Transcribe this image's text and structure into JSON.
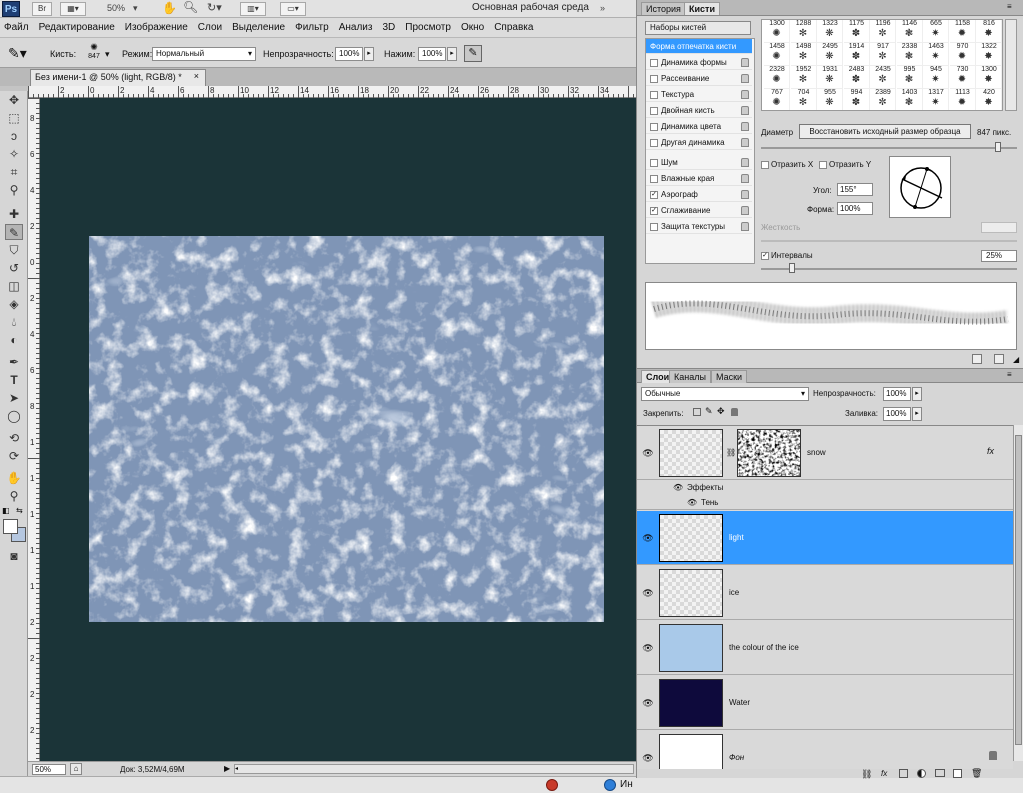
{
  "appbar": {
    "logo": "Ps",
    "br_label": "Br",
    "zoom": "50%",
    "workspace": "Основная рабочая среда"
  },
  "menu": [
    "Файл",
    "Редактирование",
    "Изображение",
    "Слои",
    "Выделение",
    "Фильтр",
    "Анализ",
    "3D",
    "Просмотр",
    "Окно",
    "Справка"
  ],
  "options": {
    "brush_label": "Кисть:",
    "brush_size": "847",
    "mode_label": "Режим:",
    "mode_value": "Нормальный",
    "opacity_label": "Непрозрачность:",
    "opacity_value": "100%",
    "flow_label": "Нажим:",
    "flow_value": "100%"
  },
  "document": {
    "tab_title": "Без имени-1 @ 50% (light, RGB/8) *",
    "close": "×",
    "ruler_h": [
      "2",
      "0",
      "2",
      "4",
      "6",
      "8",
      "10",
      "12",
      "14",
      "16",
      "18",
      "20",
      "22",
      "24",
      "26",
      "28",
      "30",
      "32",
      "34"
    ],
    "ruler_v": [
      "8",
      "6",
      "4",
      "2",
      "0",
      "2",
      "4",
      "6",
      "8",
      "1",
      "1",
      "1",
      "1",
      "1",
      "2",
      "2",
      "2",
      "2"
    ]
  },
  "status": {
    "zoom": "50%",
    "doc": "Док: 3,52M/4,69M"
  },
  "taskbar": {
    "text": "Ин"
  },
  "brush_panel": {
    "tabs": [
      "История",
      "Кисти"
    ],
    "presets_btn": "Наборы кистей",
    "items": [
      {
        "label": "Форма отпечатка кисти",
        "checkbox": false,
        "selected": true,
        "lock": false
      },
      {
        "label": "Динамика формы",
        "checkbox": true,
        "checked": false,
        "lock": true
      },
      {
        "label": "Рассеивание",
        "checkbox": true,
        "checked": false,
        "lock": true
      },
      {
        "label": "Текстура",
        "checkbox": true,
        "checked": false,
        "lock": true
      },
      {
        "label": "Двойная кисть",
        "checkbox": true,
        "checked": false,
        "lock": true
      },
      {
        "label": "Динамика цвета",
        "checkbox": true,
        "checked": false,
        "lock": true
      },
      {
        "label": "Другая динамика",
        "checkbox": true,
        "checked": false,
        "lock": true
      },
      {
        "label": "Шум",
        "checkbox": true,
        "checked": false,
        "lock": true
      },
      {
        "label": "Влажные края",
        "checkbox": true,
        "checked": false,
        "lock": true
      },
      {
        "label": "Аэрограф",
        "checkbox": true,
        "checked": true,
        "lock": true
      },
      {
        "label": "Сглаживание",
        "checkbox": true,
        "checked": true,
        "lock": true
      },
      {
        "label": "Защита текстуры",
        "checkbox": true,
        "checked": false,
        "lock": true
      }
    ],
    "brush_rows": [
      [
        "1300",
        "1288",
        "1323",
        "1175",
        "1196",
        "1146",
        "665",
        "1158",
        "816"
      ],
      [
        "1458",
        "1498",
        "2495",
        "1914",
        "917",
        "2338",
        "1463",
        "970",
        "1322"
      ],
      [
        "2328",
        "1952",
        "1931",
        "2483",
        "2435",
        "995",
        "945",
        "730",
        "1300"
      ],
      [
        "767",
        "704",
        "955",
        "994",
        "2389",
        "1403",
        "1317",
        "1113",
        "420"
      ]
    ],
    "diameter_label": "Диаметр",
    "restore_btn": "Восстановить исходный размер образца",
    "diameter_value": "847 пикс.",
    "flip_x": "Отразить X",
    "flip_y": "Отразить Y",
    "angle_label": "Угол:",
    "angle_value": "155°",
    "roundness_label": "Форма:",
    "roundness_value": "100%",
    "hardness_label": "Жесткость",
    "spacing_label": "Интервалы",
    "spacing_value": "25%",
    "spacing_checked": true
  },
  "layers_panel": {
    "tabs": [
      "Слои",
      "Каналы",
      "Маски"
    ],
    "blend_mode": "Обычные",
    "opacity_label": "Непрозрачность:",
    "opacity_value": "100%",
    "lock_label": "Закрепить:",
    "fill_label": "Заливка:",
    "fill_value": "100%",
    "layers": [
      {
        "name": "snow",
        "thumb": "checker",
        "has_mask": true,
        "fx": "fx"
      },
      {
        "name": "light",
        "thumb": "checker",
        "selected": true
      },
      {
        "name": "ice",
        "thumb": "checker"
      },
      {
        "name": "the colour of the ice",
        "thumb": "#a9c9e9"
      },
      {
        "name": "Water",
        "thumb": "#0e0a3c"
      },
      {
        "name": "Фон",
        "thumb": "#ffffff",
        "locked": true
      }
    ],
    "effects_label": "Эффекты",
    "shadow_label": "Тень"
  },
  "colors": {
    "pasteboard": "#1b3438",
    "selected_layer": "#3399ff",
    "annotation": "#d41414"
  }
}
